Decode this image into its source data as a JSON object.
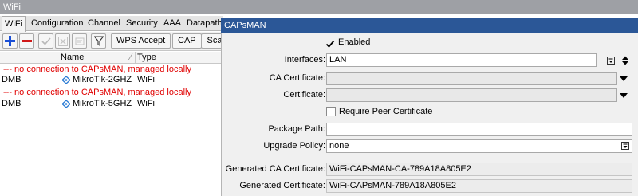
{
  "wifi_window": {
    "title": "WiFi",
    "tabs": [
      "WiFi",
      "Configuration",
      "Channel",
      "Security",
      "AAA",
      "Datapath"
    ],
    "toolbar": {
      "wps_accept_label": "WPS Accept",
      "cap_label": "CAP",
      "scan_label_partial": "Sca"
    },
    "columns": {
      "name": "Name",
      "type": "Type"
    },
    "rows": [
      {
        "kind": "comment",
        "text": "--- no connection to CAPsMAN, managed locally"
      },
      {
        "kind": "item",
        "flags": "DMB",
        "name": "MikroTik-2GHZ",
        "type": "WiFi"
      },
      {
        "kind": "comment",
        "text": "--- no connection to CAPsMAN, managed locally"
      },
      {
        "kind": "item",
        "flags": "DMB",
        "name": "MikroTik-5GHZ",
        "type": "WiFi"
      }
    ],
    "colors": {
      "comment": "#e00000",
      "accent_add": "#1a4fd6",
      "accent_remove": "#d01818"
    }
  },
  "capsman": {
    "title": "CAPsMAN",
    "enabled_label": "Enabled",
    "enabled_checked": true,
    "fields": {
      "interfaces": {
        "label": "Interfaces:",
        "value": "LAN"
      },
      "ca_certificate": {
        "label": "CA Certificate:",
        "value": ""
      },
      "certificate": {
        "label": "Certificate:",
        "value": ""
      },
      "require_peer_cert": {
        "label": "Require Peer Certificate",
        "checked": false
      },
      "package_path": {
        "label": "Package Path:",
        "value": ""
      },
      "upgrade_policy": {
        "label": "Upgrade Policy:",
        "value": "none"
      },
      "generated_ca_certificate": {
        "label": "Generated CA Certificate:",
        "value": "WiFi-CAPsMAN-CA-789A18A805E2"
      },
      "generated_certificate": {
        "label": "Generated Certificate:",
        "value": "WiFi-CAPsMAN-789A18A805E2"
      }
    },
    "colors": {
      "titlebar": "#2b5797"
    }
  }
}
